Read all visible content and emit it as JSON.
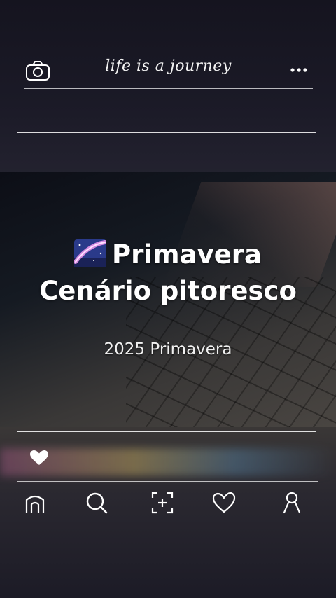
{
  "header": {
    "logo_text": "life is a journey",
    "left_icon": "camera-icon",
    "right_icon": "more-icon"
  },
  "post": {
    "title_emoji": "milky-way-emoji",
    "title_line1": "Primavera",
    "title_line2": "Cenário pitoresco",
    "subtitle": "2025 Primavera"
  },
  "actions": {
    "like_icon": "heart-icon"
  },
  "bottom_nav": {
    "items": [
      {
        "icon": "home-icon"
      },
      {
        "icon": "search-icon"
      },
      {
        "icon": "add-icon"
      },
      {
        "icon": "heart-outline-icon"
      },
      {
        "icon": "profile-icon"
      }
    ]
  },
  "colors": {
    "background": "#141320",
    "foreground": "#ffffff",
    "frame_border": "#ffffff"
  }
}
